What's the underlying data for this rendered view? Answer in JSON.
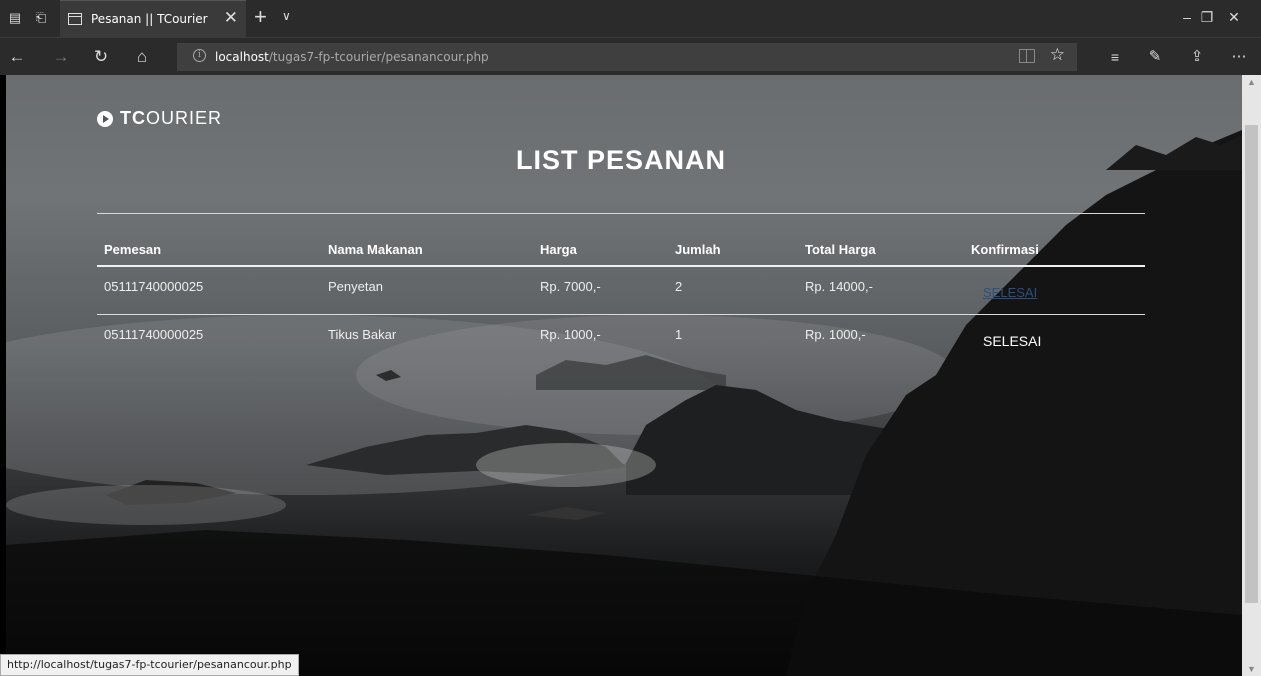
{
  "browser": {
    "tab_title": "Pesanan || TCourier",
    "url_host": "localhost",
    "url_path": "/tugas7-fp-tcourier/pesanancour.php",
    "status_url": "http://localhost/tugas7-fp-tcourier/pesanancour.php",
    "icons": {
      "tab_preview": "tab-preview-icon",
      "set_aside": "set-aside-tabs-icon",
      "page": "page-icon",
      "close_tab": "close-icon",
      "new_tab": "plus-icon",
      "tab_menu": "chevron-down-icon",
      "minimize": "minimize-icon",
      "restore": "restore-icon",
      "close_window": "close-icon",
      "back": "back-arrow-icon",
      "forward": "forward-arrow-icon",
      "refresh": "refresh-icon",
      "home": "home-icon",
      "site_info": "info-icon",
      "reading_view": "reading-view-icon",
      "favorite": "star-icon",
      "favorites_hub": "favorites-hub-icon",
      "notes": "pen-icon",
      "share": "share-icon",
      "more": "more-icon"
    }
  },
  "page": {
    "logo_bold": "TC",
    "logo_rest": "OURIER",
    "title": "LIST PESANAN",
    "table": {
      "headers": [
        "Pemesan",
        "Nama Makanan",
        "Harga",
        "Jumlah",
        "Total Harga",
        "Konfirmasi"
      ],
      "rows": [
        {
          "pemesan": "05111740000025",
          "makanan": "Penyetan",
          "harga": "Rp. 7000,-",
          "jumlah": "2",
          "total": "Rp. 14000,-",
          "konfirmasi": "SELESAI"
        },
        {
          "pemesan": "05111740000025",
          "makanan": "Tikus Bakar",
          "harga": "Rp. 1000,-",
          "jumlah": "1",
          "total": "Rp. 1000,-",
          "konfirmasi": "SELESAI"
        }
      ]
    }
  },
  "colors": {
    "link": "#2b4f7e",
    "chrome_bg": "#2b2b2b",
    "text": "#ffffff"
  }
}
